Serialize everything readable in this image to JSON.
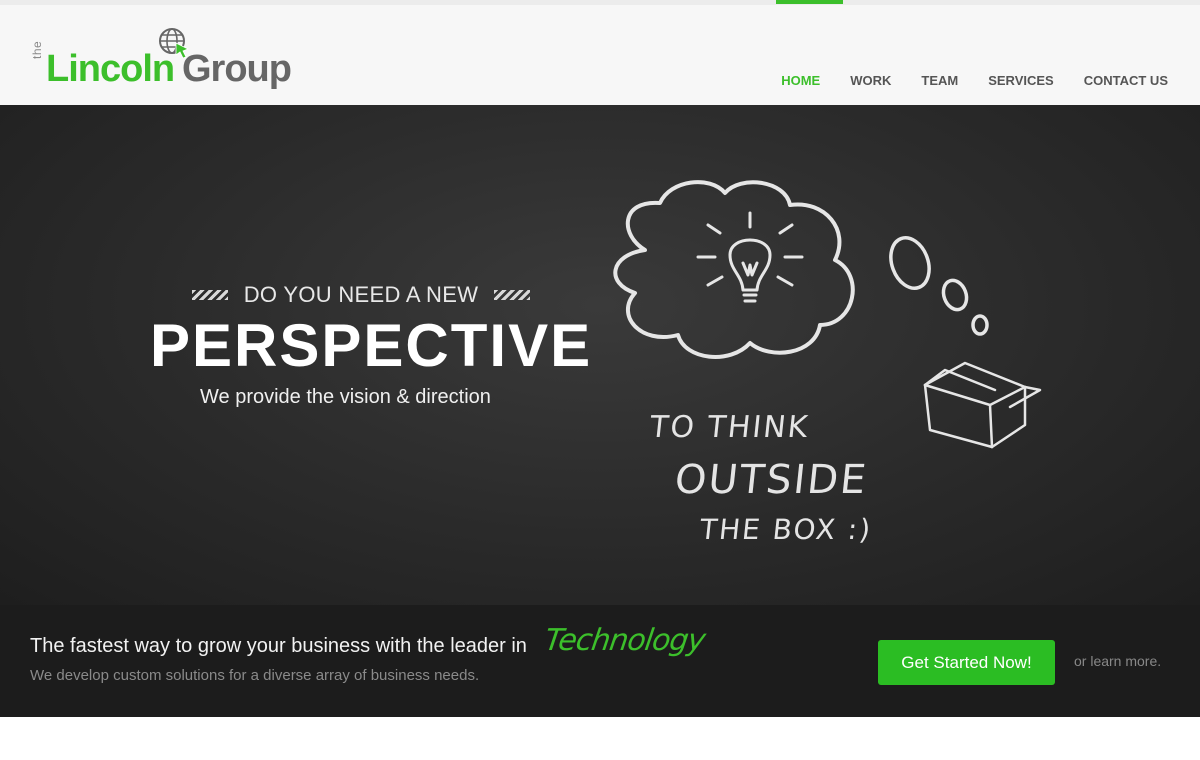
{
  "header": {
    "logo": {
      "the": "the",
      "lincoln": "Lincoln",
      "group": "Group"
    },
    "nav": [
      {
        "label": "HOME",
        "active": true
      },
      {
        "label": "WORK",
        "active": false
      },
      {
        "label": "TEAM",
        "active": false
      },
      {
        "label": "SERVICES",
        "active": false
      },
      {
        "label": "CONTACT US",
        "active": false
      }
    ]
  },
  "hero": {
    "kicker": "DO YOU NEED A NEW",
    "title": "PERSPECTIVE",
    "subtitle": "We provide the vision & direction",
    "chalk_line1": "TO THINK",
    "chalk_line2": "OUTSIDE",
    "chalk_line3": "THE BOX :)"
  },
  "band": {
    "title": "The fastest way to grow your business with the leader in",
    "highlight": "Technology",
    "subtitle": "We develop custom solutions for a diverse array of business needs.",
    "cta_label": "Get Started Now!",
    "learn_more": "or learn more."
  },
  "colors": {
    "accent": "#3cbf2b",
    "hero_bg": "#2a2a2a",
    "band_bg": "#1c1c1c"
  },
  "icons": [
    "globe-cursor-icon",
    "lightbulb-icon",
    "thought-cloud-icon",
    "box-icon"
  ]
}
